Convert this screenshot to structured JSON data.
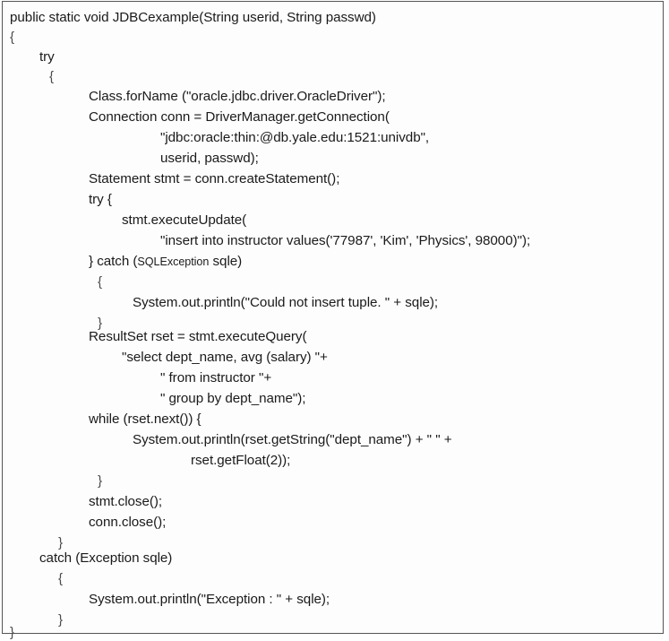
{
  "listing": {
    "lines": [
      "public static void JDBCexample(String userid, String passwd)",
      "{",
      "try",
      "{",
      "Class.forName (\"oracle.jdbc.driver.OracleDriver\");",
      "Connection conn = DriverManager.getConnection(",
      "\"jdbc:oracle:thin:@db.yale.edu:1521:univdb\",",
      "userid, passwd);",
      "Statement stmt = conn.createStatement();",
      "try {",
      "stmt.executeUpdate(",
      "\"insert into instructor values('77987', 'Kim', 'Physics', 98000)\");",
      "} catch (",
      "SQLException",
      " sqle)",
      "{",
      "System.out.println(\"Could not insert tuple. \" + sqle);",
      "}",
      "ResultSet rset = stmt.executeQuery(",
      "\"select dept_name, avg (salary) \"+",
      "\" from instructor \"+",
      "\" group by dept_name\");",
      "while (rset.next()) {",
      "System.out.println(rset.getString(\"dept_name\") + \" \" +",
      "rset.getFloat(2));",
      "}",
      "stmt.close();",
      "conn.close();",
      "}",
      "catch (Exception sqle)",
      "{",
      "System.out.println(\"Exception : \" + sqle);",
      "}",
      "}"
    ]
  }
}
